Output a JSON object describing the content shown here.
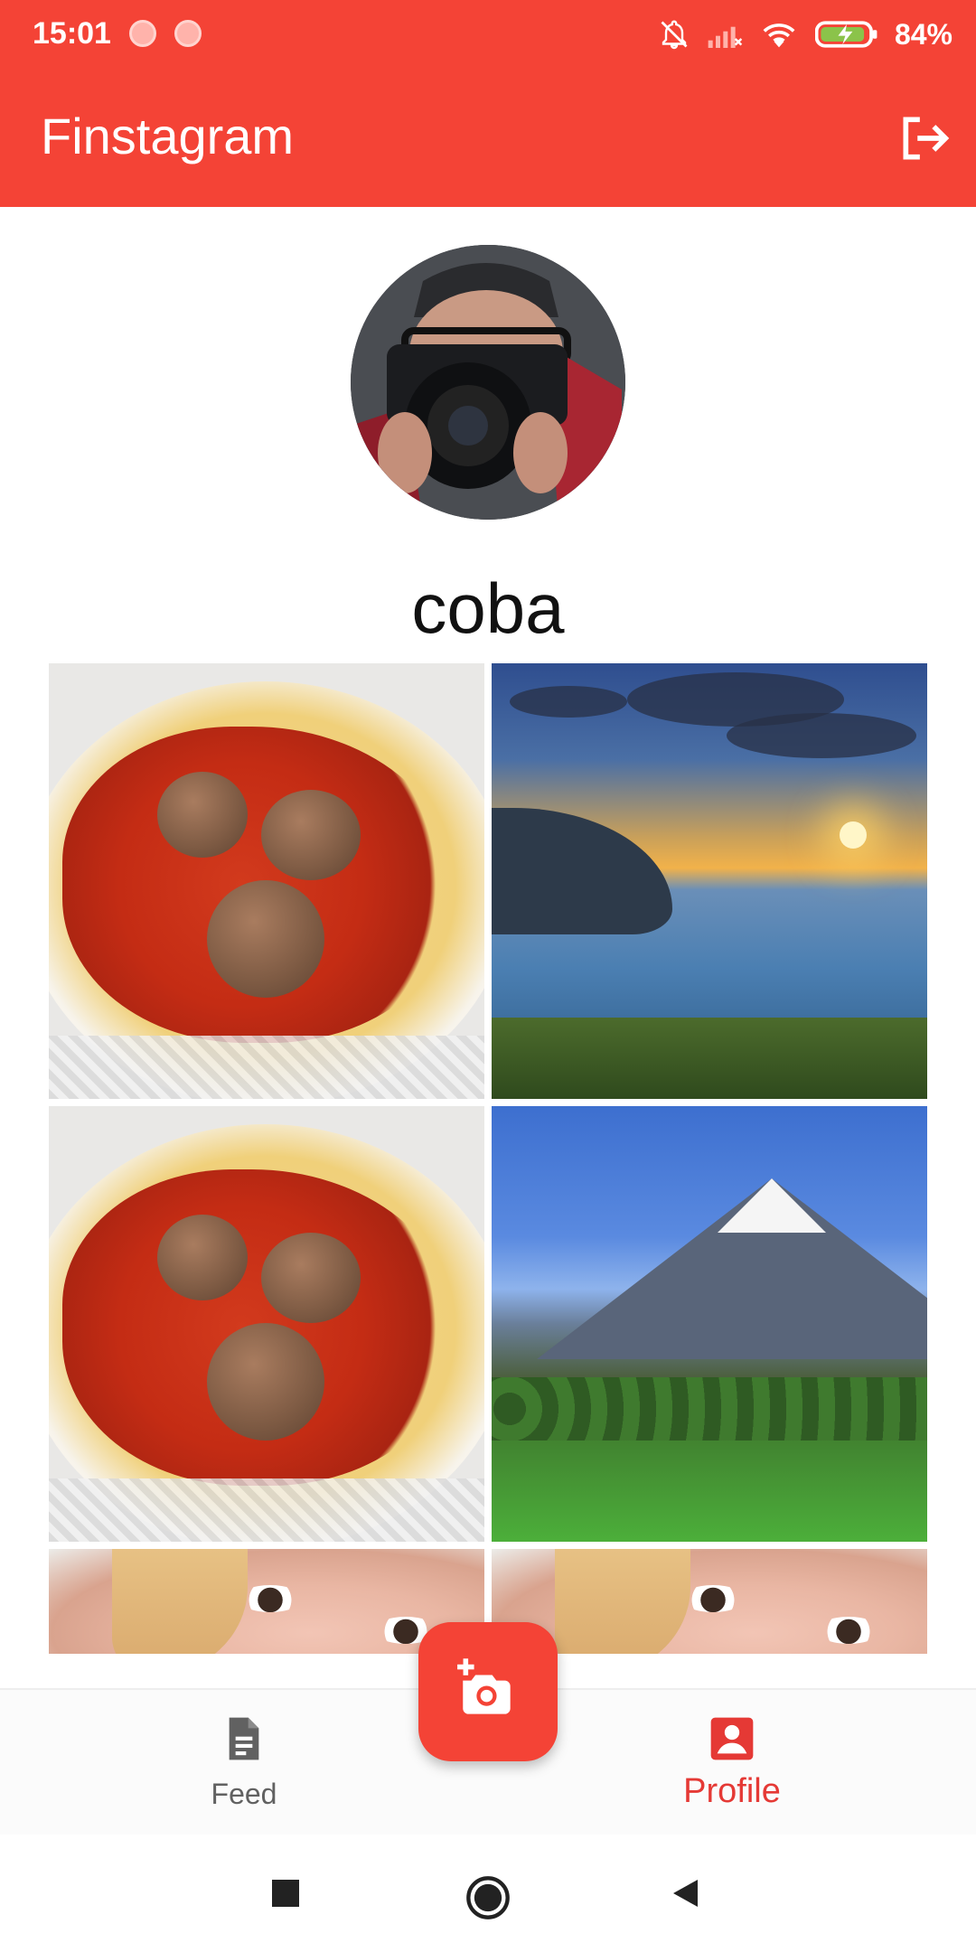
{
  "status_bar": {
    "time": "15:01",
    "battery": "84%",
    "icons": [
      "notification-dot-icon",
      "notification-dot-icon",
      "bell-off-icon",
      "signal-icon",
      "wifi-icon",
      "battery-charging-icon"
    ]
  },
  "app_bar": {
    "title": "Finstagram",
    "actions": [
      "logout-icon"
    ]
  },
  "profile": {
    "username": "coba",
    "avatar": "avatar-photo"
  },
  "grid": {
    "posts": [
      "spaghetti-meatballs-photo",
      "lake-sunset-photo",
      "spaghetti-meatballs-photo",
      "mountain-landscape-photo",
      "portrait-photo",
      "portrait-photo"
    ]
  },
  "fab": {
    "icon": "add-photo-icon"
  },
  "bottom_nav": {
    "items": [
      {
        "label": "Feed",
        "icon": "document-icon",
        "selected": false
      },
      {
        "label": "Profile",
        "icon": "account-box-icon",
        "selected": true
      }
    ],
    "colors": {
      "accent": "#F44336",
      "inactive": "#616161"
    }
  },
  "system_nav": {
    "icons": [
      "recent-apps-icon",
      "home-icon",
      "back-icon"
    ]
  }
}
